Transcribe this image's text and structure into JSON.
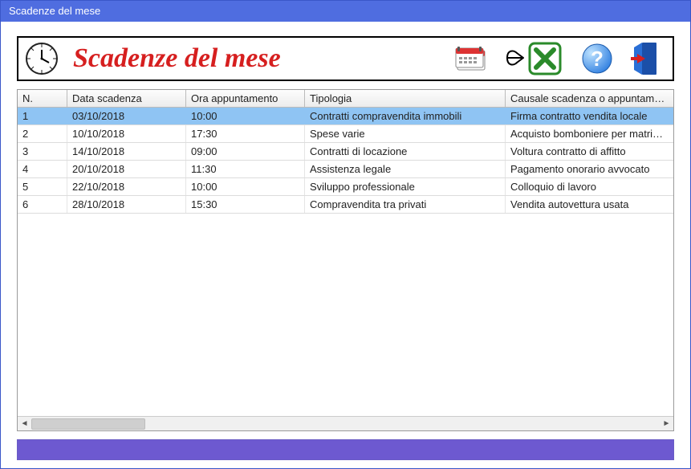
{
  "window": {
    "title": "Scadenze del mese"
  },
  "header": {
    "title": "Scadenze del mese"
  },
  "columns": {
    "c0": "N.",
    "c1": "Data scadenza",
    "c2": "Ora appuntamento",
    "c3": "Tipologia",
    "c4": "Causale scadenza o appuntamento"
  },
  "rows": [
    {
      "n": "1",
      "date": "03/10/2018",
      "time": "10:00",
      "type": "Contratti compravendita immobili",
      "cause": "Firma contratto vendita locale",
      "selected": true
    },
    {
      "n": "2",
      "date": "10/10/2018",
      "time": "17:30",
      "type": "Spese varie",
      "cause": "Acquisto bomboniere per matrimonio",
      "selected": false
    },
    {
      "n": "3",
      "date": "14/10/2018",
      "time": "09:00",
      "type": "Contratti di locazione",
      "cause": "Voltura contratto di affitto",
      "selected": false
    },
    {
      "n": "4",
      "date": "20/10/2018",
      "time": "11:30",
      "type": "Assistenza legale",
      "cause": "Pagamento onorario avvocato",
      "selected": false
    },
    {
      "n": "5",
      "date": "22/10/2018",
      "time": "10:00",
      "type": "Sviluppo professionale",
      "cause": "Colloquio di lavoro",
      "selected": false
    },
    {
      "n": "6",
      "date": "28/10/2018",
      "time": "15:30",
      "type": "Compravendita tra privati",
      "cause": "Vendita autovettura usata",
      "selected": false
    }
  ]
}
